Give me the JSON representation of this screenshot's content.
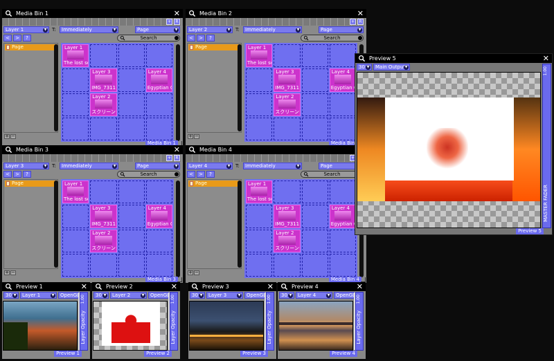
{
  "colors": {
    "accent": "#7a7aee",
    "filled": "#cc33cc",
    "page_row": "#e89a1a",
    "titlebar": "#000000"
  },
  "icons": {
    "search": "magnifier-icon",
    "close": "close-icon",
    "page": "page-icon"
  },
  "media_bins": [
    {
      "title": "Media Bin 1",
      "layer": "Layer 1",
      "trigger_label": "T:",
      "trigger": "Immediately",
      "page": "Page",
      "search": "Search",
      "page_item": "Page",
      "footer": "Media Bin 1",
      "btn_plus": "+",
      "btn_r": "R",
      "nav_prev": "<",
      "nav_next": ">",
      "nav_help": "?",
      "list_plus": "+",
      "list_minus": "−",
      "cells": [
        {
          "title": "Layer 1",
          "file": "The lost sea"
        },
        {
          "title": "Layer 3",
          "file": "IMG_7311"
        },
        {
          "title": "Layer 4",
          "file": "Egyptian Ci"
        },
        {
          "title": "Layer 2",
          "file": "スクリーンシ"
        }
      ]
    },
    {
      "title": "Media Bin 2",
      "layer": "Layer 2",
      "trigger_label": "T:",
      "trigger": "Immediately",
      "page": "Page",
      "search": "Search",
      "page_item": "Page",
      "footer": "Media Bin 2",
      "btn_plus": "+",
      "btn_r": "R",
      "nav_prev": "<",
      "nav_next": ">",
      "nav_help": "?",
      "list_plus": "+",
      "list_minus": "−",
      "cells": [
        {
          "title": "Layer 1",
          "file": "The lost sea"
        },
        {
          "title": "Layer 3",
          "file": "IMG_7311"
        },
        {
          "title": "Layer 4",
          "file": "Egyptian Ci"
        },
        {
          "title": "Layer 2",
          "file": "スクリーンシ"
        }
      ]
    },
    {
      "title": "Media Bin 3",
      "layer": "Layer 3",
      "trigger_label": "T:",
      "trigger": "Immediately",
      "page": "Page",
      "search": "Search",
      "page_item": "Page",
      "footer": "Media Bin 3",
      "btn_plus": "+",
      "btn_r": "R",
      "nav_prev": "<",
      "nav_next": ">",
      "nav_help": "?",
      "list_plus": "+",
      "list_minus": "−",
      "cells": [
        {
          "title": "Layer 1",
          "file": "The lost sea"
        },
        {
          "title": "Layer 3",
          "file": "IMG_7311"
        },
        {
          "title": "Layer 4",
          "file": "Egyptian Ci"
        },
        {
          "title": "Layer 2",
          "file": "スクリーンシ"
        }
      ]
    },
    {
      "title": "Media Bin 4",
      "layer": "Layer 4",
      "trigger_label": "T:",
      "trigger": "Immediately",
      "page": "Page",
      "search": "Search",
      "page_item": "Page",
      "footer": "Media Bin 4",
      "btn_plus": "+",
      "btn_r": "R",
      "nav_prev": "<",
      "nav_next": ">",
      "nav_help": "?",
      "list_plus": "+",
      "list_minus": "−",
      "cells": [
        {
          "title": "Layer 1",
          "file": "The lost sea"
        },
        {
          "title": "Layer 3",
          "file": "IMG_7311"
        },
        {
          "title": "Layer 4",
          "file": "Egyptian Ci"
        },
        {
          "title": "Layer 2",
          "file": "スクリーンシ"
        }
      ]
    }
  ],
  "preview5": {
    "title": "Preview 5",
    "fps": "30",
    "output": "Main Output",
    "fader_value": "1.00",
    "fader_label": "MASTER FADER",
    "footer": "Preview 5"
  },
  "small_previews": [
    {
      "title": "Preview 1",
      "fps": "30",
      "layer": "Layer 1",
      "renderer": "OpenGL-",
      "value": "1.00",
      "side_label": "Layer Opacity",
      "footer": "Preview 1"
    },
    {
      "title": "Preview 2",
      "fps": "30",
      "layer": "Layer 2",
      "renderer": "OpenGL-",
      "value": "1.00",
      "side_label": "Layer Opacity",
      "footer": "Preview 2"
    },
    {
      "title": "Preview 3",
      "fps": "30",
      "layer": "Layer 3",
      "renderer": "OpenGL-",
      "value": "1.00",
      "side_label": "Layer Opacity",
      "footer": "Preview 3"
    },
    {
      "title": "Preview 4",
      "fps": "30",
      "layer": "Layer 4",
      "renderer": "OpenGL-",
      "value": "1.00",
      "side_label": "Layer Opacity",
      "footer": "Preview 4"
    }
  ]
}
